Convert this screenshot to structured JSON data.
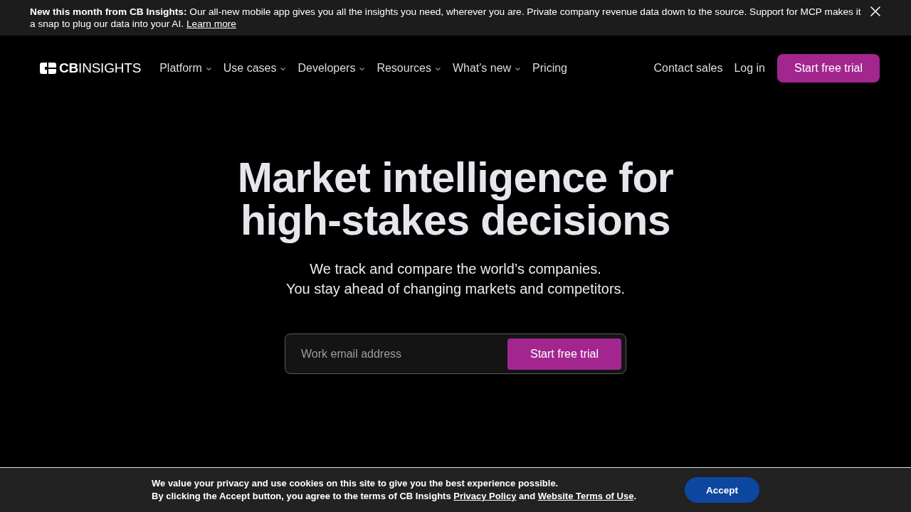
{
  "announcement": {
    "text": "**New this month from CB Insights:** Our all-new mobile app gives you all the insights you need, wherever you are. Private company revenue data down to the source. Support for MCP makes it a snap to plug our data into your AI.",
    "link": "Learn more",
    "dismissible": true
  },
  "nav": {
    "logo": "**CB**INSIGHTS",
    "menu": [
      {
        "label": "Platform",
        "dropdown": true
      },
      {
        "label": "Use cases",
        "dropdown": true
      },
      {
        "label": "Developers",
        "dropdown": true
      },
      {
        "label": "Resources",
        "dropdown": true
      },
      {
        "label": "What's new",
        "dropdown": true
      },
      {
        "label": "Pricing",
        "dropdown": false
      }
    ],
    "actions": [
      {
        "label": "Contact sales",
        "kind": "link"
      },
      {
        "label": "Log in",
        "kind": "link"
      },
      {
        "label": "Start free trial",
        "kind": "button"
      }
    ]
  },
  "hero": {
    "title": "Market intelligence for high-stakes decisions",
    "subtitle": [
      "We track and compare the world’s companies.",
      "You stay ahead of changing markets and competitors."
    ],
    "email": {
      "placeholder": "Work email address"
    },
    "cta": "Start free trial"
  },
  "cookie_banner": {
    "message": "We value your privacy and use cookies on this site to give you the best experience possible.",
    "consent": [
      {
        "kind": "text",
        "text": "By clicking the Accept button, you agree to the terms of CB Insights "
      },
      {
        "kind": "link",
        "text": "Privacy Policy"
      },
      {
        "kind": "text",
        "text": " and "
      },
      {
        "kind": "link",
        "text": "Website Terms of Use"
      },
      {
        "kind": "text",
        "text": "."
      }
    ],
    "button": "Accept"
  }
}
